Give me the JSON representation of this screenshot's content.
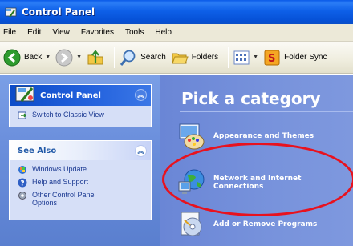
{
  "window": {
    "title": "Control Panel"
  },
  "menu": [
    "File",
    "Edit",
    "View",
    "Favorites",
    "Tools",
    "Help"
  ],
  "toolbar": {
    "back_label": "Back",
    "search_label": "Search",
    "folders_label": "Folders",
    "foldersync_label": "Folder Sync"
  },
  "sidebar": {
    "panel1": {
      "title": "Control Panel",
      "link": "Switch to Classic View"
    },
    "panel2": {
      "title": "See Also",
      "items": [
        "Windows Update",
        "Help and Support",
        "Other Control Panel Options"
      ]
    }
  },
  "main": {
    "heading": "Pick a category",
    "categories": [
      "Appearance and Themes",
      "Network and Internet Connections",
      "Add or Remove Programs"
    ]
  },
  "colors": {
    "titlebar": "#0651d6",
    "annotation": "#e8121e",
    "content_bg": "#7893dc"
  }
}
